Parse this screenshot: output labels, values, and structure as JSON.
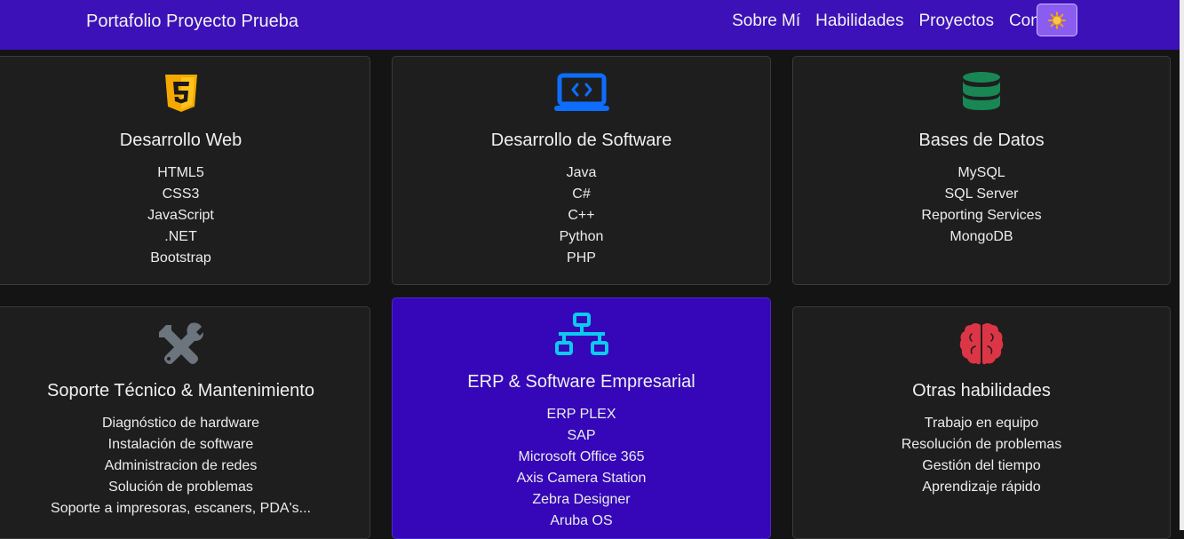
{
  "navbar": {
    "brand": "Portafolio Proyecto Prueba",
    "links": [
      "Sobre Mí",
      "Habilidades",
      "Proyectos",
      "Contacto"
    ],
    "theme_toggle_icon": "sun-icon",
    "bg_color": "#3c12b8"
  },
  "cards": [
    {
      "icon": "html5-icon",
      "title": "Desarrollo Web",
      "items": [
        "HTML5",
        "CSS3",
        "JavaScript",
        ".NET",
        "Bootstrap"
      ],
      "icon_color": "#f5a800"
    },
    {
      "icon": "laptop-code-icon",
      "title": "Desarrollo de Software",
      "items": [
        "Java",
        "C#",
        "C++",
        "Python",
        "PHP"
      ],
      "icon_color": "#0d6efd"
    },
    {
      "icon": "database-icon",
      "title": "Bases de Datos",
      "items": [
        "MySQL",
        "SQL Server",
        "Reporting Services",
        "MongoDB"
      ],
      "icon_color": "#198754"
    },
    {
      "icon": "tools-icon",
      "title": "Soporte Técnico & Mantenimiento",
      "items": [
        "Diagnóstico de hardware",
        "Instalación de software",
        "Administracion de redes",
        "Solución de problemas",
        "Soporte a impresoras, escaners, PDA's..."
      ],
      "icon_color": "#6c757d"
    },
    {
      "icon": "network-icon",
      "title": "ERP & Software Empresarial",
      "items": [
        "ERP PLEX",
        "SAP",
        "Microsoft Office 365",
        "Axis Camera Station",
        "Zebra Designer",
        "Aruba OS"
      ],
      "icon_color": "#0dcaf0",
      "highlighted": true
    },
    {
      "icon": "brain-icon",
      "title": "Otras habilidades",
      "items": [
        "Trabajo en equipo",
        "Resolución de problemas",
        "Gestión del tiempo",
        "Aprendizaje rápido"
      ],
      "icon_color": "#dc3545"
    }
  ]
}
